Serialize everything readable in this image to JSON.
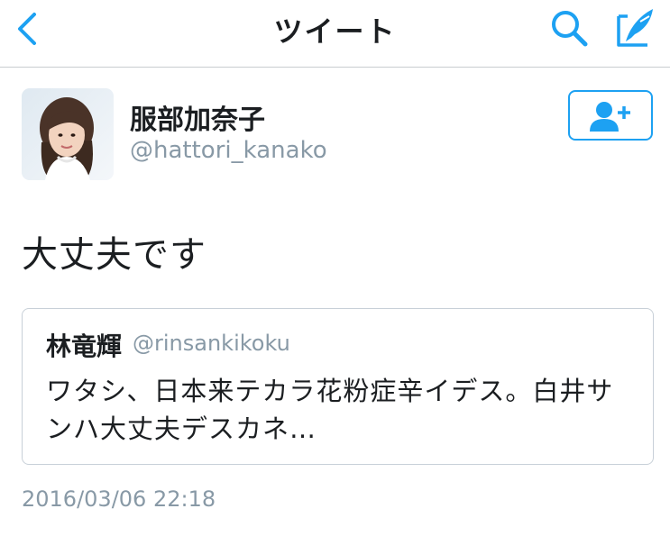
{
  "nav": {
    "title": "ツイート"
  },
  "tweet": {
    "display_name": "服部加奈子",
    "handle": "@hattori_kanako",
    "text": "大丈夫です",
    "timestamp": "2016/03/06 22:18"
  },
  "quote": {
    "display_name": "林竜輝",
    "handle": "@rinsankikoku",
    "text": "ワタシ、日本来テカラ花粉症辛イデス。白井サンハ大丈夫デスカネ…"
  },
  "colors": {
    "accent": "#1da1f2",
    "secondary_text": "#8899a6",
    "divider": "#c8ccd0"
  },
  "icons": [
    "back-icon",
    "search-icon",
    "compose-icon",
    "follow-icon"
  ]
}
